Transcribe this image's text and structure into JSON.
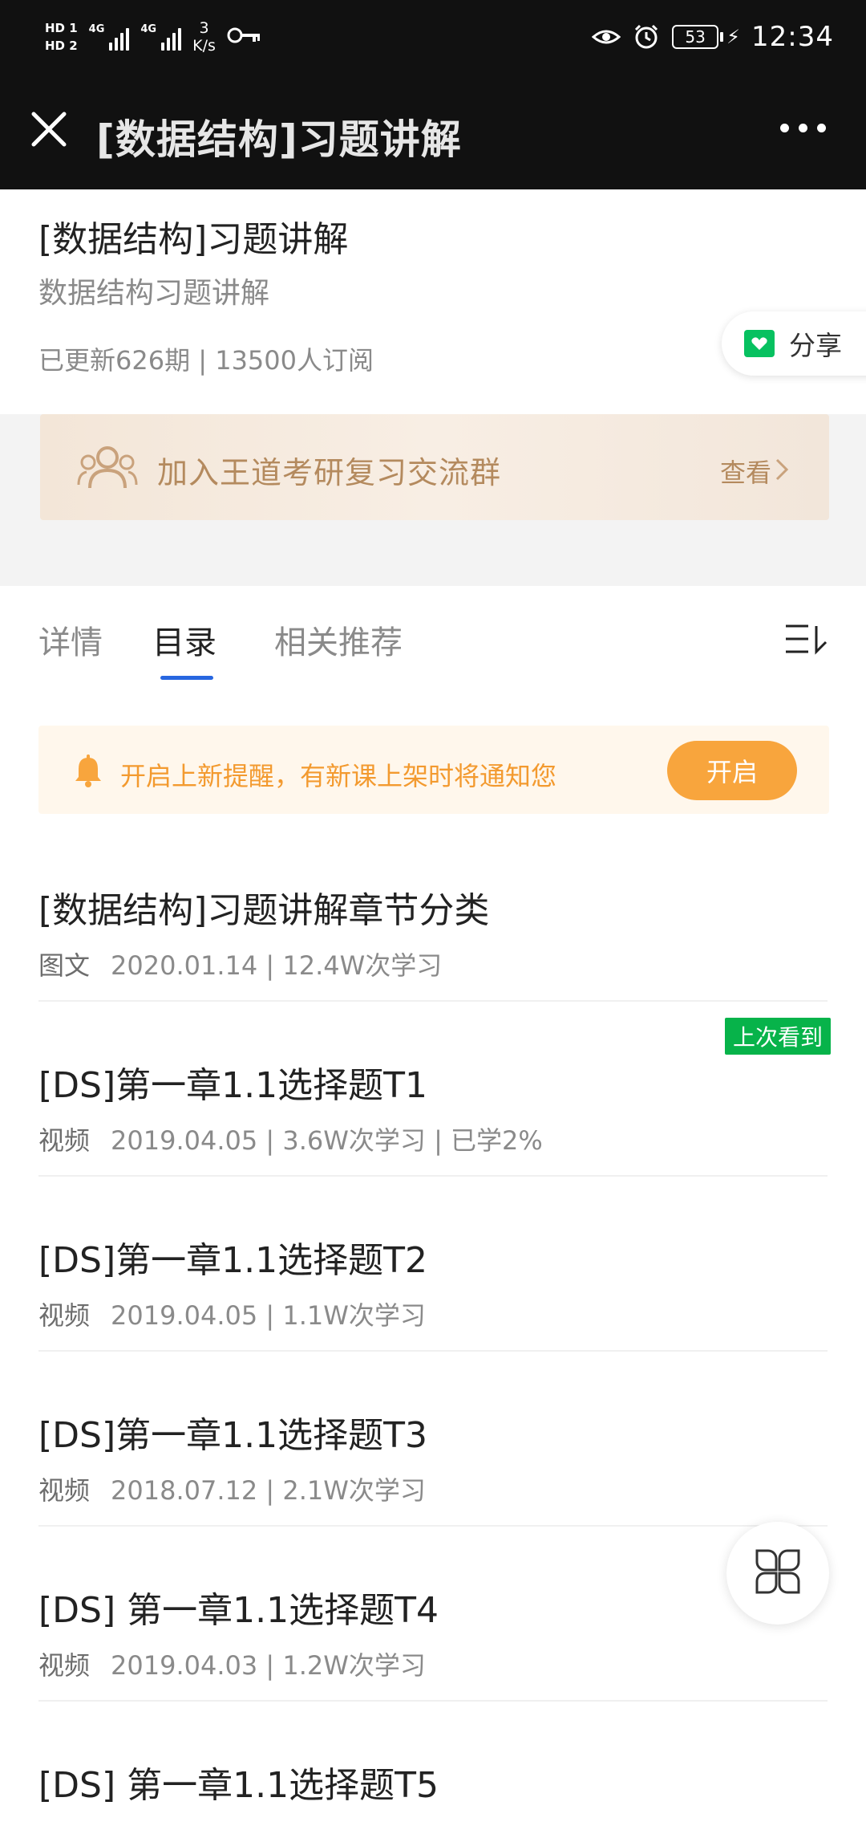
{
  "status_bar": {
    "sim1": "HD 1",
    "sim2": "HD 2",
    "network1": "4G",
    "network2": "4G",
    "speed_value": "3",
    "speed_unit": "K/s",
    "battery": "53",
    "time": "12:34",
    "icons": [
      "key-icon",
      "eye-icon",
      "alarm-icon",
      "battery-icon",
      "charging-icon"
    ]
  },
  "title_bar": {
    "title": "[数据结构]习题讲解"
  },
  "course": {
    "title": "[数据结构]习题讲解",
    "subtitle": "数据结构习题讲解",
    "stats": "已更新626期 | 13500人订阅",
    "share_label": "分享"
  },
  "group_banner": {
    "text": "加入王道考研复习交流群",
    "action": "查看"
  },
  "tabs": [
    {
      "label": "详情",
      "active": false
    },
    {
      "label": "目录",
      "active": true
    },
    {
      "label": "相关推荐",
      "active": false
    }
  ],
  "notify": {
    "text": "开启上新提醒，有新课上架时将通知您",
    "button": "开启"
  },
  "list": [
    {
      "title": "[数据结构]习题讲解章节分类",
      "type": "图文",
      "meta": "2020.01.14 | 12.4W次学习"
    },
    {
      "title": "[DS]第一章1.1选择题T1",
      "type": "视频",
      "meta": "2019.04.05 | 3.6W次学习 | 已学2%"
    },
    {
      "title": "[DS]第一章1.1选择题T2",
      "type": "视频",
      "meta": "2019.04.05 | 1.1W次学习"
    },
    {
      "title": "[DS]第一章1.1选择题T3",
      "type": "视频",
      "meta": "2018.07.12 | 2.1W次学习"
    },
    {
      "title": "[DS] 第一章1.1选择题T4",
      "type": "视频",
      "meta": "2019.04.03 | 1.2W次学习"
    },
    {
      "title": "[DS] 第一章1.1选择题T5",
      "type": "",
      "meta": ""
    }
  ],
  "last_seen_badge": "上次看到",
  "colors": {
    "accent_blue": "#2766e0",
    "notify_orange": "#f8a53d",
    "wechat_green": "#07c160",
    "banner_gold": "#b48a5e"
  }
}
